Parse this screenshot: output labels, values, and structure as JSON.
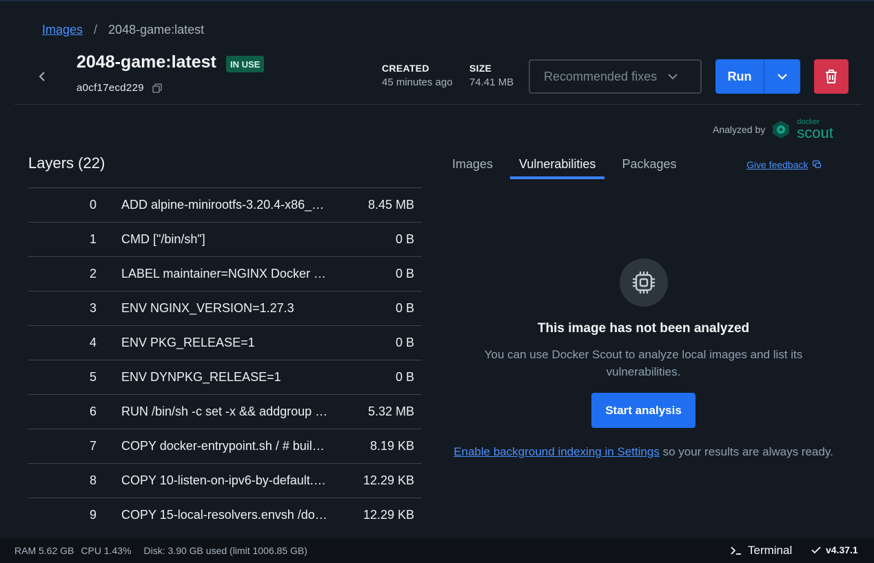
{
  "breadcrumb": {
    "link": "Images",
    "separator": "/",
    "current": "2048-game:latest"
  },
  "header": {
    "title": "2048-game:latest",
    "badge": "IN USE",
    "image_id": "a0cf17ecd229",
    "created_label": "CREATED",
    "created_value": "45 minutes ago",
    "size_label": "SIZE",
    "size_value": "74.41 MB",
    "recommended_fixes": "Recommended fixes",
    "run_label": "Run"
  },
  "analyzed_by": {
    "text": "Analyzed by",
    "brand_small": "docker",
    "brand_large": "scout"
  },
  "layers": {
    "title": "Layers (22)",
    "rows": [
      {
        "index": "0",
        "command": "ADD alpine-minirootfs-3.20.4-x86_6…",
        "size": "8.45 MB"
      },
      {
        "index": "1",
        "command": "CMD [\"/bin/sh\"]",
        "size": "0 B"
      },
      {
        "index": "2",
        "command": "LABEL maintainer=NGINX Docker …",
        "size": "0 B"
      },
      {
        "index": "3",
        "command": "ENV NGINX_VERSION=1.27.3",
        "size": "0 B"
      },
      {
        "index": "4",
        "command": "ENV PKG_RELEASE=1",
        "size": "0 B"
      },
      {
        "index": "5",
        "command": "ENV DYNPKG_RELEASE=1",
        "size": "0 B"
      },
      {
        "index": "6",
        "command": "RUN /bin/sh -c set -x && addgroup -…",
        "size": "5.32 MB"
      },
      {
        "index": "7",
        "command": "COPY docker-entrypoint.sh / # buil…",
        "size": "8.19 KB"
      },
      {
        "index": "8",
        "command": "COPY 10-listen-on-ipv6-by-default.s…",
        "size": "12.29 KB"
      },
      {
        "index": "9",
        "command": "COPY 15-local-resolvers.envsh /do…",
        "size": "12.29 KB"
      }
    ]
  },
  "tabs": [
    {
      "label": "Images",
      "active": false
    },
    {
      "label": "Vulnerabilities",
      "active": true
    },
    {
      "label": "Packages",
      "active": false
    }
  ],
  "feedback": "Give feedback",
  "empty_state": {
    "icon": "chip-icon",
    "title": "This image has not been analyzed",
    "description": "You can use Docker Scout to analyze local images and list its vulnerabilities.",
    "button": "Start analysis",
    "link_text": "Enable background indexing in Settings",
    "link_suffix": " so your results are always ready."
  },
  "statusbar": {
    "ram": "RAM 5.62 GB",
    "cpu": "CPU 1.43%",
    "disk": "Disk: 3.90 GB used (limit 1006.85 GB)",
    "terminal": "Terminal",
    "version": "v4.37.1"
  },
  "colors": {
    "background": "#141a21",
    "accent": "#1f6ff0",
    "danger": "#d3334b",
    "badge": "#0e5d47",
    "scout": "#15a68c"
  }
}
